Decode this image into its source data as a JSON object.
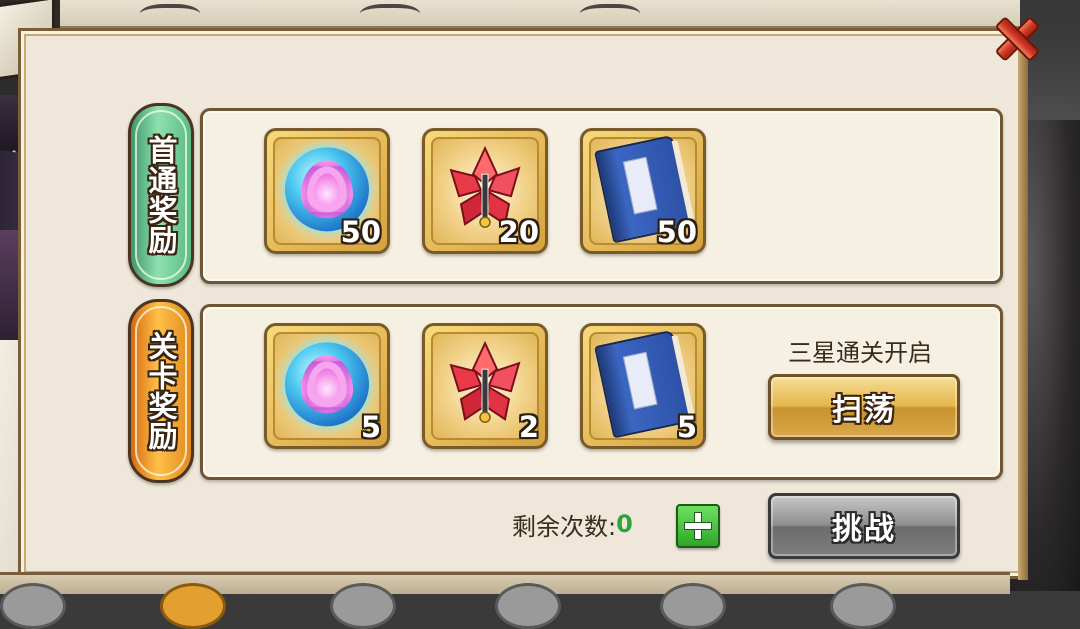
{
  "dialog": {
    "first_clear_label": "首通奖励",
    "stage_reward_label": "关卡奖励"
  },
  "first_clear_rewards": [
    {
      "icon": "spirit-orb-icon",
      "count": "50"
    },
    {
      "icon": "red-crystal-icon",
      "count": "20"
    },
    {
      "icon": "skill-book-icon",
      "count": "50"
    }
  ],
  "stage_rewards": [
    {
      "icon": "spirit-orb-icon",
      "count": "5"
    },
    {
      "icon": "red-crystal-icon",
      "count": "2"
    },
    {
      "icon": "skill-book-icon",
      "count": "5"
    }
  ],
  "sweep": {
    "hint": "三星通关开启",
    "button_label": "扫荡"
  },
  "remaining": {
    "label": "剩余次数:",
    "value": "0"
  },
  "challenge": {
    "button_label": "挑战"
  },
  "colors": {
    "panel_bg": "#efe8da",
    "first_clear_tag": "#5abb84",
    "stage_tag": "#e08a20",
    "remaining_value": "#2fa53a",
    "sweep_button": "#e4b64e",
    "challenge_button": "#8e8e8e"
  },
  "icons": {
    "close": "close-icon",
    "add": "plus-icon"
  }
}
